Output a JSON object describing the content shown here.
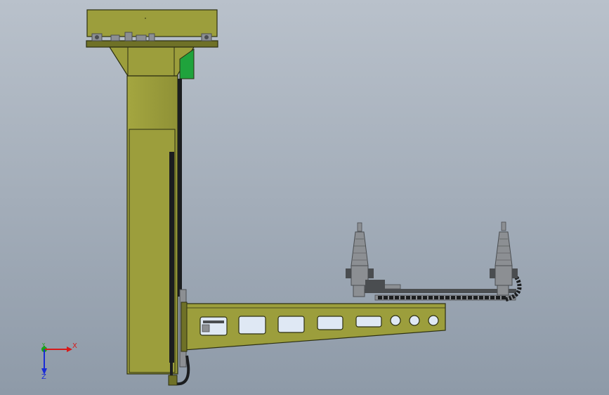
{
  "viewport": {
    "background_top": "#b9c1cb",
    "background_bottom": "#8e9aa8"
  },
  "colors": {
    "body": "#9c9e3c",
    "body_dark": "#6f7127",
    "outline": "#2c2f12",
    "cable": "#1b1d1f",
    "green_plate": "#1fa33c",
    "cutout_blue": "#dfe8f4",
    "metal": "#8c8f93",
    "metal_dark": "#4a4d50",
    "axis_x": "#d71a1a",
    "axis_y": "#1aa21a",
    "axis_z": "#1a2bd6"
  },
  "triad": {
    "x_label": "X",
    "y_label": "Y",
    "z_label": "Z"
  }
}
